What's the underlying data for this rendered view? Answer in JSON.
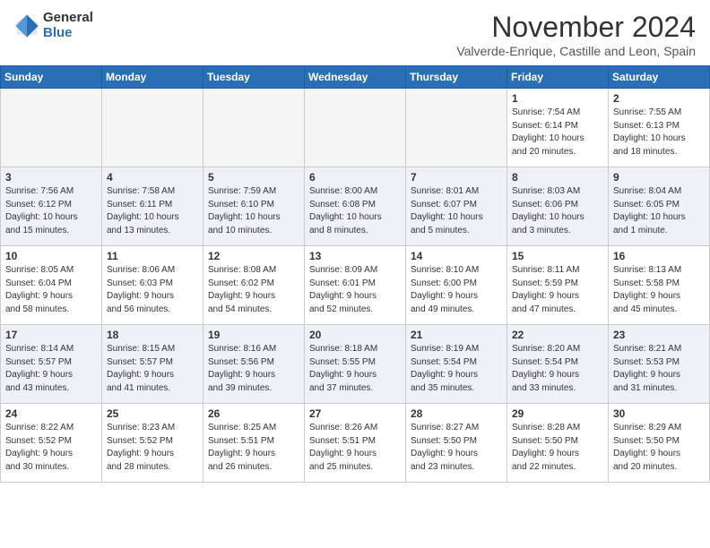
{
  "header": {
    "logo_general": "General",
    "logo_blue": "Blue",
    "month_title": "November 2024",
    "location": "Valverde-Enrique, Castille and Leon, Spain"
  },
  "weekdays": [
    "Sunday",
    "Monday",
    "Tuesday",
    "Wednesday",
    "Thursday",
    "Friday",
    "Saturday"
  ],
  "weeks": [
    [
      {
        "day": "",
        "info": ""
      },
      {
        "day": "",
        "info": ""
      },
      {
        "day": "",
        "info": ""
      },
      {
        "day": "",
        "info": ""
      },
      {
        "day": "",
        "info": ""
      },
      {
        "day": "1",
        "info": "Sunrise: 7:54 AM\nSunset: 6:14 PM\nDaylight: 10 hours\nand 20 minutes."
      },
      {
        "day": "2",
        "info": "Sunrise: 7:55 AM\nSunset: 6:13 PM\nDaylight: 10 hours\nand 18 minutes."
      }
    ],
    [
      {
        "day": "3",
        "info": "Sunrise: 7:56 AM\nSunset: 6:12 PM\nDaylight: 10 hours\nand 15 minutes."
      },
      {
        "day": "4",
        "info": "Sunrise: 7:58 AM\nSunset: 6:11 PM\nDaylight: 10 hours\nand 13 minutes."
      },
      {
        "day": "5",
        "info": "Sunrise: 7:59 AM\nSunset: 6:10 PM\nDaylight: 10 hours\nand 10 minutes."
      },
      {
        "day": "6",
        "info": "Sunrise: 8:00 AM\nSunset: 6:08 PM\nDaylight: 10 hours\nand 8 minutes."
      },
      {
        "day": "7",
        "info": "Sunrise: 8:01 AM\nSunset: 6:07 PM\nDaylight: 10 hours\nand 5 minutes."
      },
      {
        "day": "8",
        "info": "Sunrise: 8:03 AM\nSunset: 6:06 PM\nDaylight: 10 hours\nand 3 minutes."
      },
      {
        "day": "9",
        "info": "Sunrise: 8:04 AM\nSunset: 6:05 PM\nDaylight: 10 hours\nand 1 minute."
      }
    ],
    [
      {
        "day": "10",
        "info": "Sunrise: 8:05 AM\nSunset: 6:04 PM\nDaylight: 9 hours\nand 58 minutes."
      },
      {
        "day": "11",
        "info": "Sunrise: 8:06 AM\nSunset: 6:03 PM\nDaylight: 9 hours\nand 56 minutes."
      },
      {
        "day": "12",
        "info": "Sunrise: 8:08 AM\nSunset: 6:02 PM\nDaylight: 9 hours\nand 54 minutes."
      },
      {
        "day": "13",
        "info": "Sunrise: 8:09 AM\nSunset: 6:01 PM\nDaylight: 9 hours\nand 52 minutes."
      },
      {
        "day": "14",
        "info": "Sunrise: 8:10 AM\nSunset: 6:00 PM\nDaylight: 9 hours\nand 49 minutes."
      },
      {
        "day": "15",
        "info": "Sunrise: 8:11 AM\nSunset: 5:59 PM\nDaylight: 9 hours\nand 47 minutes."
      },
      {
        "day": "16",
        "info": "Sunrise: 8:13 AM\nSunset: 5:58 PM\nDaylight: 9 hours\nand 45 minutes."
      }
    ],
    [
      {
        "day": "17",
        "info": "Sunrise: 8:14 AM\nSunset: 5:57 PM\nDaylight: 9 hours\nand 43 minutes."
      },
      {
        "day": "18",
        "info": "Sunrise: 8:15 AM\nSunset: 5:57 PM\nDaylight: 9 hours\nand 41 minutes."
      },
      {
        "day": "19",
        "info": "Sunrise: 8:16 AM\nSunset: 5:56 PM\nDaylight: 9 hours\nand 39 minutes."
      },
      {
        "day": "20",
        "info": "Sunrise: 8:18 AM\nSunset: 5:55 PM\nDaylight: 9 hours\nand 37 minutes."
      },
      {
        "day": "21",
        "info": "Sunrise: 8:19 AM\nSunset: 5:54 PM\nDaylight: 9 hours\nand 35 minutes."
      },
      {
        "day": "22",
        "info": "Sunrise: 8:20 AM\nSunset: 5:54 PM\nDaylight: 9 hours\nand 33 minutes."
      },
      {
        "day": "23",
        "info": "Sunrise: 8:21 AM\nSunset: 5:53 PM\nDaylight: 9 hours\nand 31 minutes."
      }
    ],
    [
      {
        "day": "24",
        "info": "Sunrise: 8:22 AM\nSunset: 5:52 PM\nDaylight: 9 hours\nand 30 minutes."
      },
      {
        "day": "25",
        "info": "Sunrise: 8:23 AM\nSunset: 5:52 PM\nDaylight: 9 hours\nand 28 minutes."
      },
      {
        "day": "26",
        "info": "Sunrise: 8:25 AM\nSunset: 5:51 PM\nDaylight: 9 hours\nand 26 minutes."
      },
      {
        "day": "27",
        "info": "Sunrise: 8:26 AM\nSunset: 5:51 PM\nDaylight: 9 hours\nand 25 minutes."
      },
      {
        "day": "28",
        "info": "Sunrise: 8:27 AM\nSunset: 5:50 PM\nDaylight: 9 hours\nand 23 minutes."
      },
      {
        "day": "29",
        "info": "Sunrise: 8:28 AM\nSunset: 5:50 PM\nDaylight: 9 hours\nand 22 minutes."
      },
      {
        "day": "30",
        "info": "Sunrise: 8:29 AM\nSunset: 5:50 PM\nDaylight: 9 hours\nand 20 minutes."
      }
    ]
  ]
}
